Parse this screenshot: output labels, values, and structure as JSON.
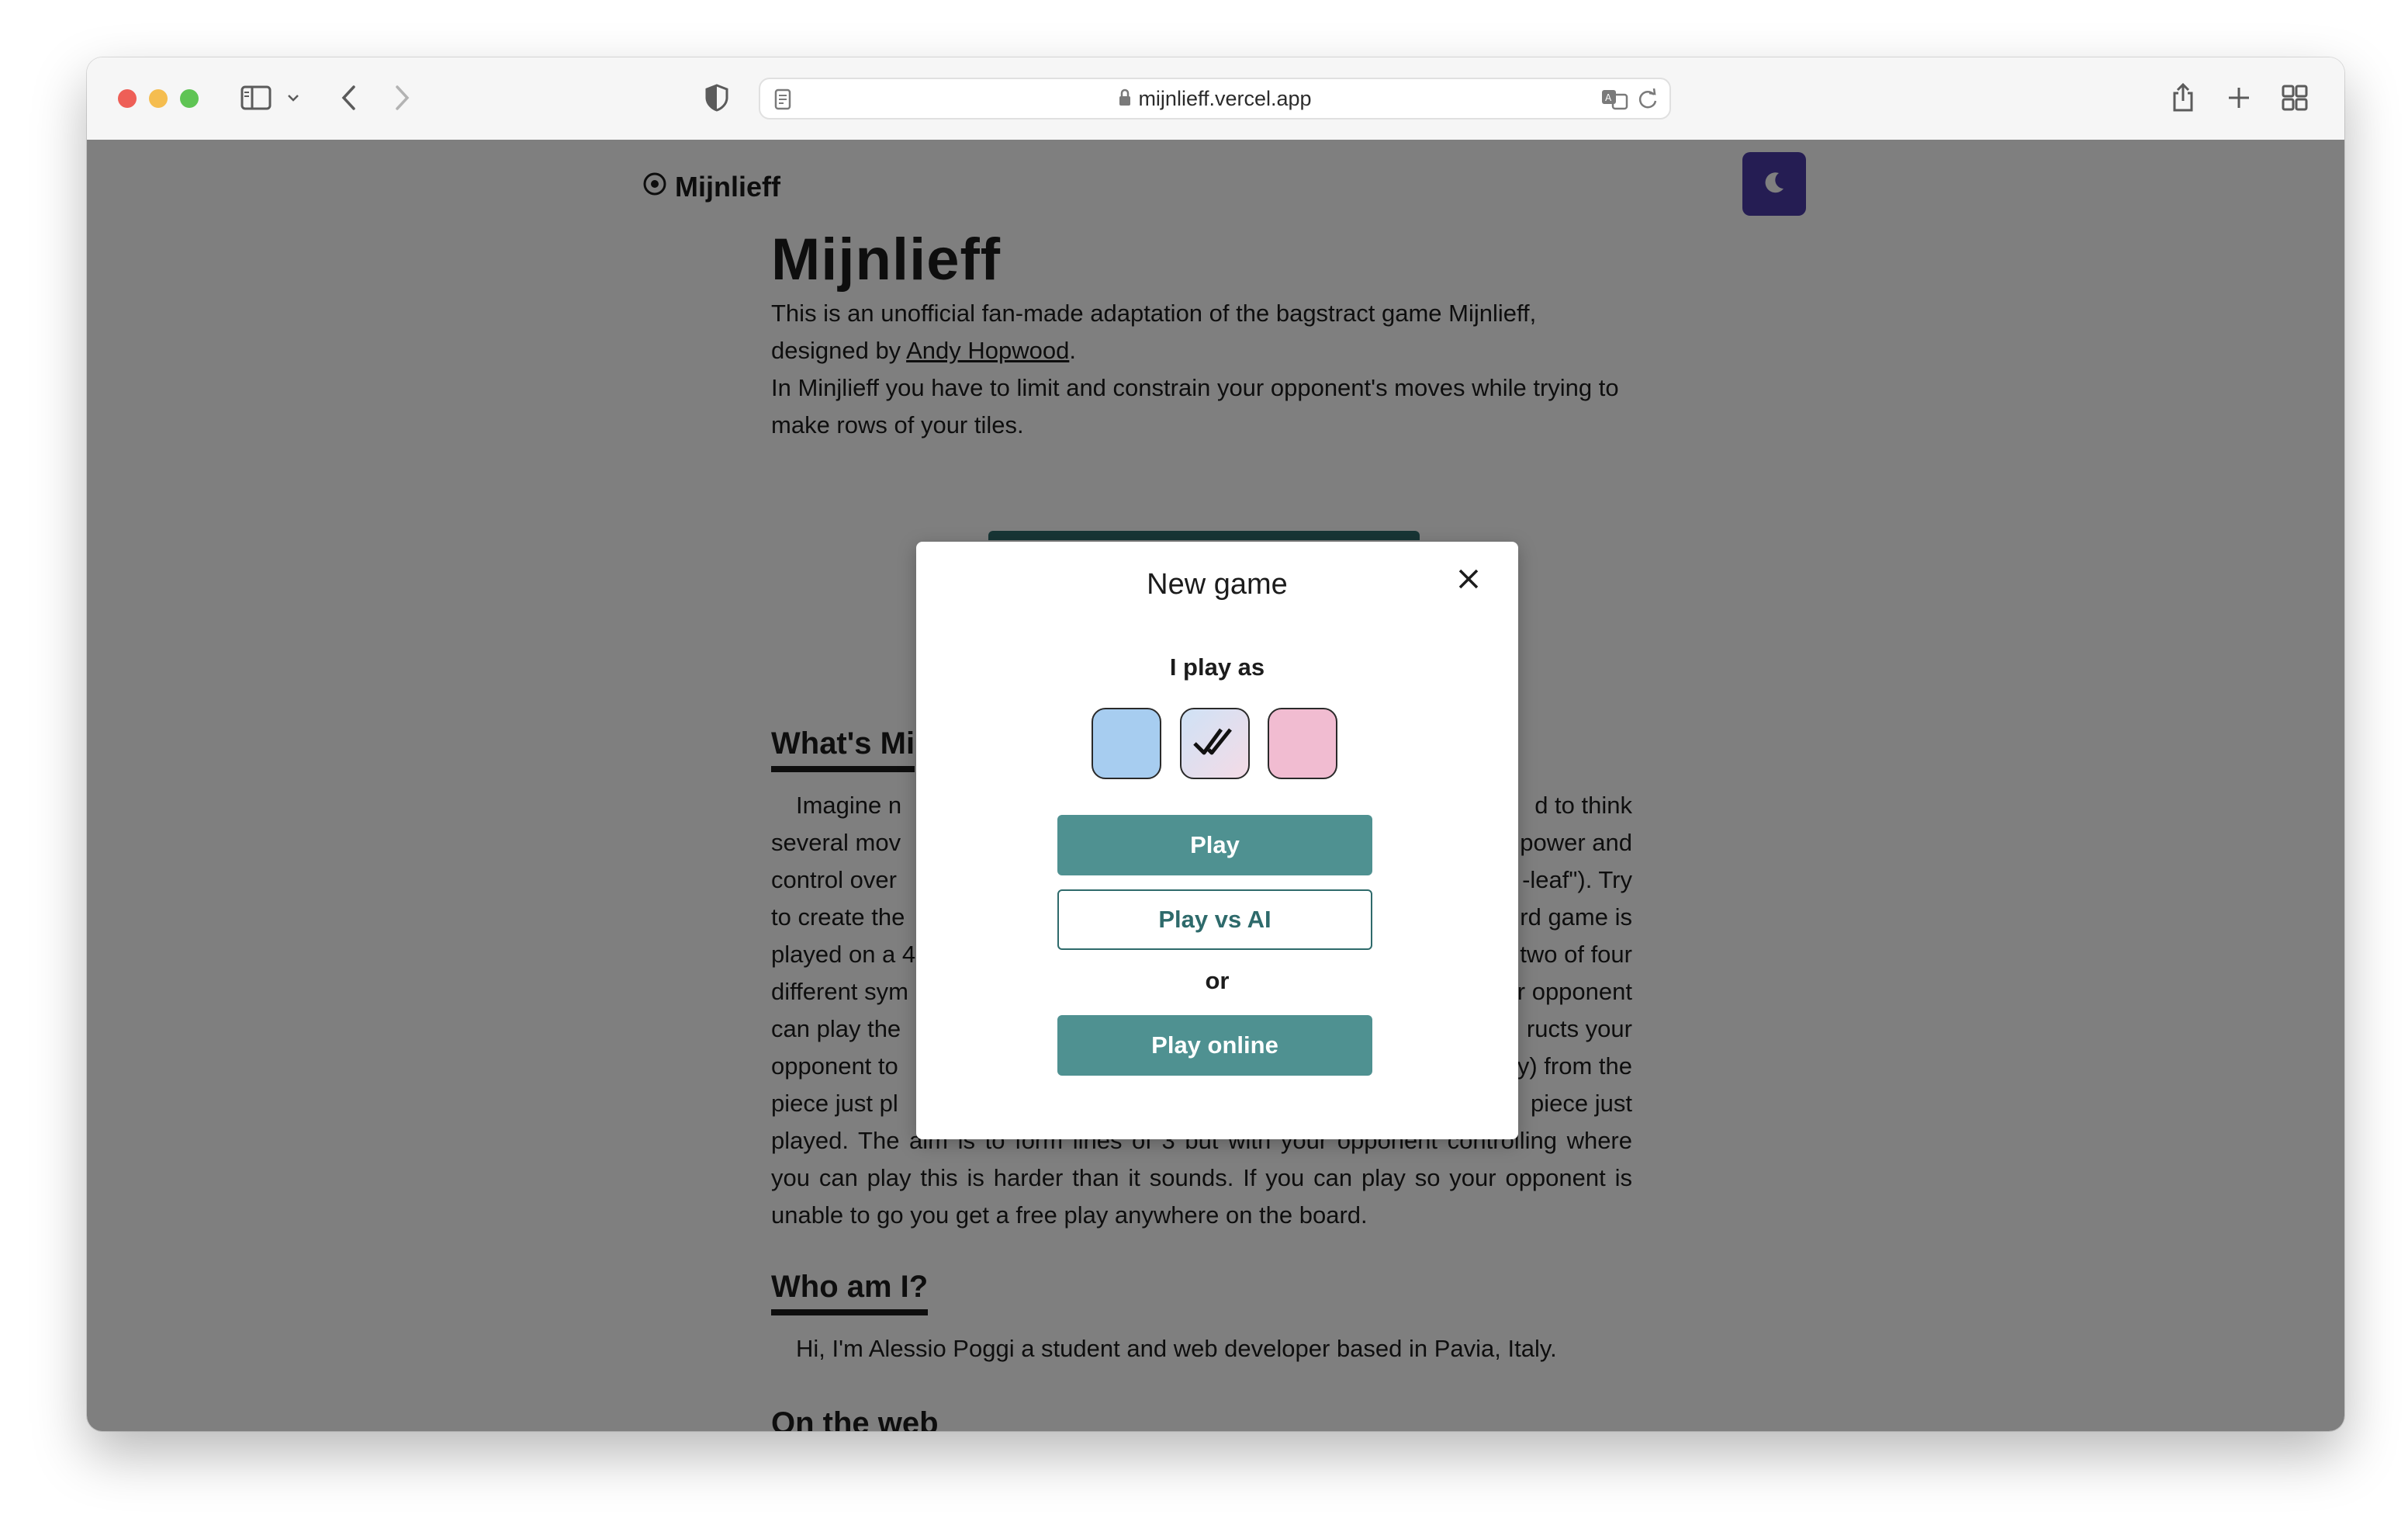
{
  "browser": {
    "url": "mijnlieff.vercel.app"
  },
  "site": {
    "brand": "Mijnlieff"
  },
  "article": {
    "title": "Mijnlieff",
    "intro_line1_prefix": "This is an unofficial fan-made adaptation of the bagstract game Mijnlieff, designed by ",
    "intro_author": "Andy Hopwood",
    "intro_line1_suffix": ".",
    "intro_line2": "In Minjlieff you have to limit and constrain your opponent's moves while trying to make rows of your tiles."
  },
  "sections": {
    "whats": {
      "heading": "What's Mi",
      "left_lines": [
        "Imagine n",
        "several mov",
        "control over",
        "to create the",
        "played on a 4",
        "different sym",
        "can play the",
        "opponent to",
        "piece just pl"
      ],
      "right_lines": [
        "d to think",
        "power and",
        "-leaf\"). Try",
        "rd game is",
        "two of four",
        "r opponent",
        "ructs your",
        "y) from the",
        "piece just"
      ],
      "tail": "played. The aim is to form lines of 3 but with your opponent controlling where you can play this is harder than it sounds. If you can play so your opponent is unable to go you get a free play anywhere on the board."
    },
    "who": {
      "heading": "Who am I?",
      "text": "Hi, I'm Alessio Poggi a student and web developer based in Pavia, Italy."
    },
    "web": {
      "heading": "On the web"
    }
  },
  "modal": {
    "title": "New game",
    "subtitle": "I play as",
    "swatches": {
      "blue_color": "#a7cdf0",
      "pink_color": "#f1bcd1",
      "selected": "both"
    },
    "play_label": "Play",
    "play_ai_label": "Play vs AI",
    "or_label": "or",
    "play_online_label": "Play online"
  },
  "colors": {
    "accent": "#4f9191",
    "theme_button": "#4a3aa6"
  }
}
